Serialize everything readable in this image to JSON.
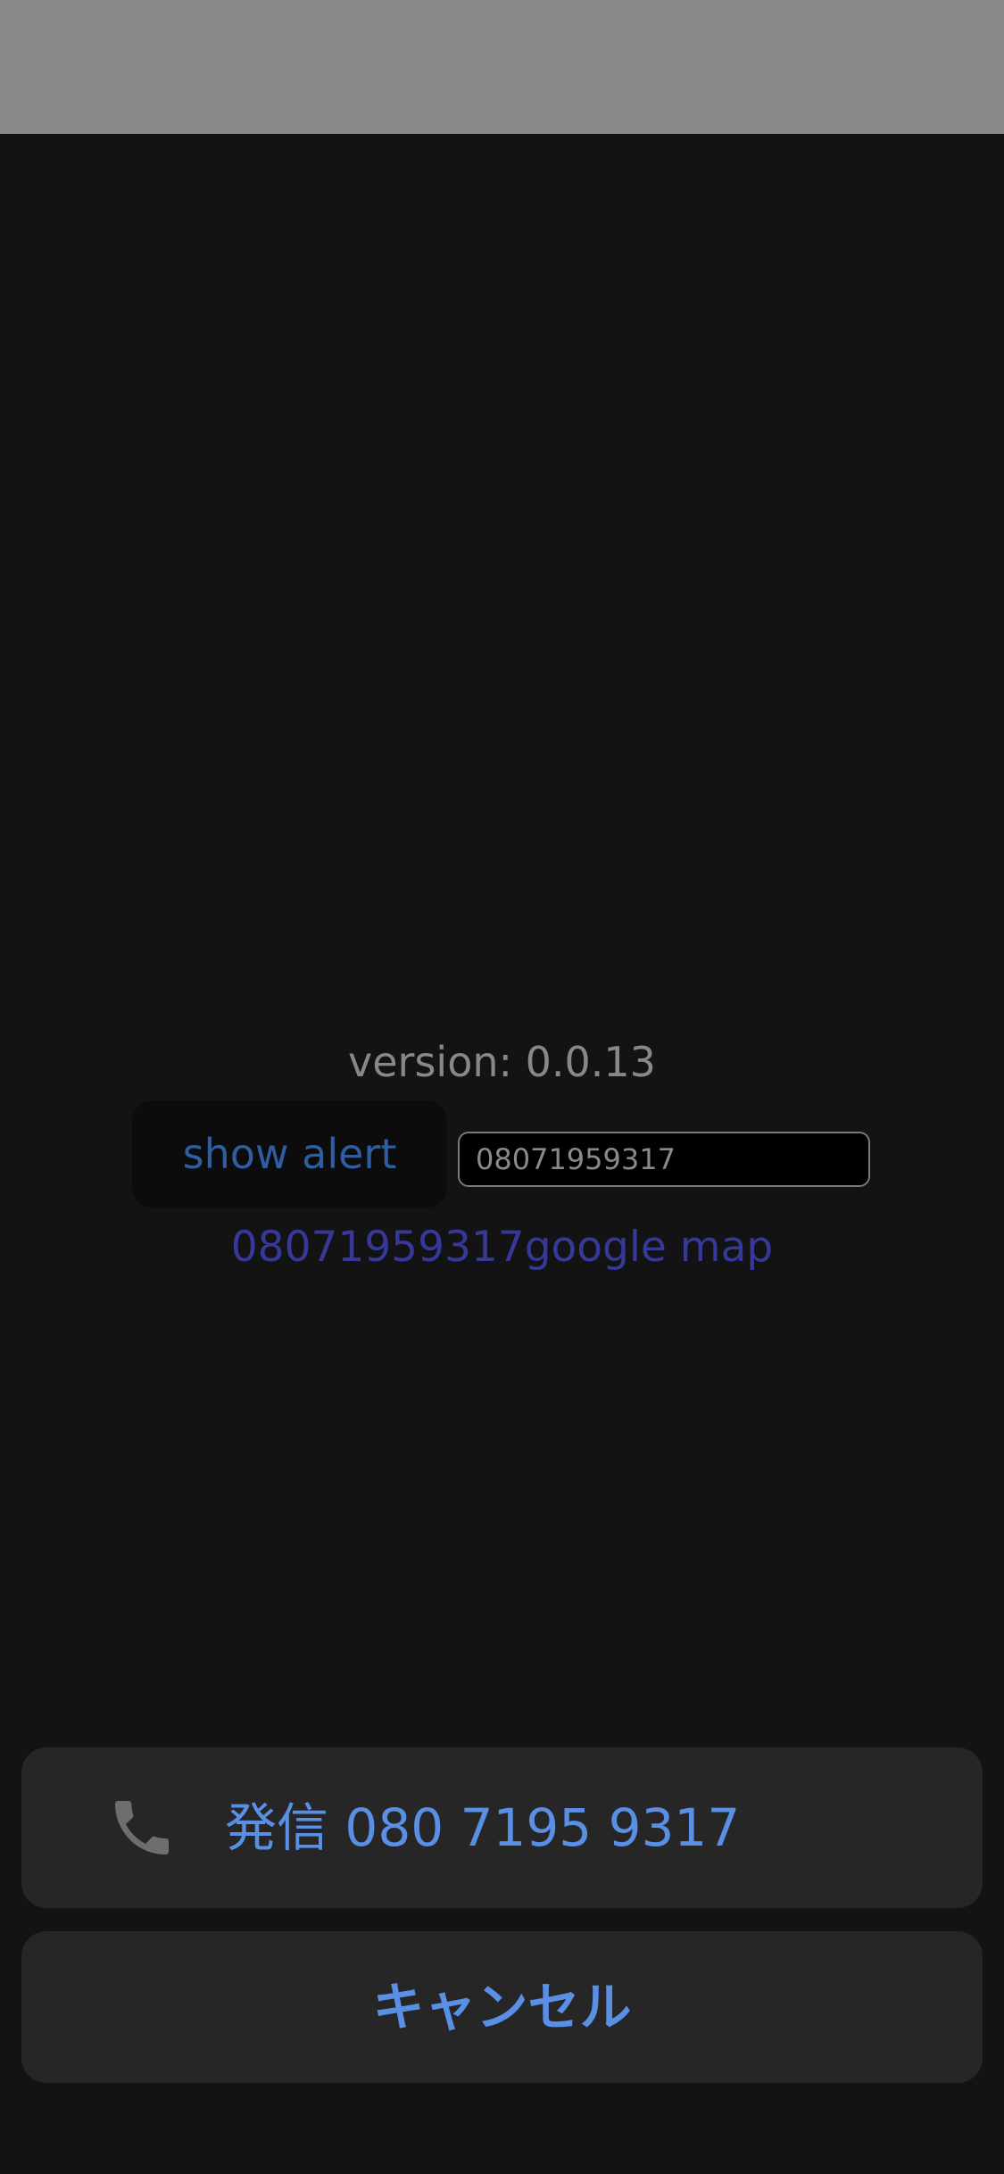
{
  "app": {
    "version_text": "version: 0.0.13",
    "show_alert_label": "show alert",
    "phone_input_value": "08071959317",
    "map_link_text": "08071959317google map"
  },
  "action_sheet": {
    "call_icon": "phone-icon",
    "call_label": "発信 080 7195 9317",
    "cancel_label": "キャンセル"
  },
  "colors": {
    "background": "#131313",
    "top_bar": "#8a8a8a",
    "sheet_background": "#262626",
    "accent_blue": "#5a8fe6",
    "link_blue": "#36389a"
  }
}
